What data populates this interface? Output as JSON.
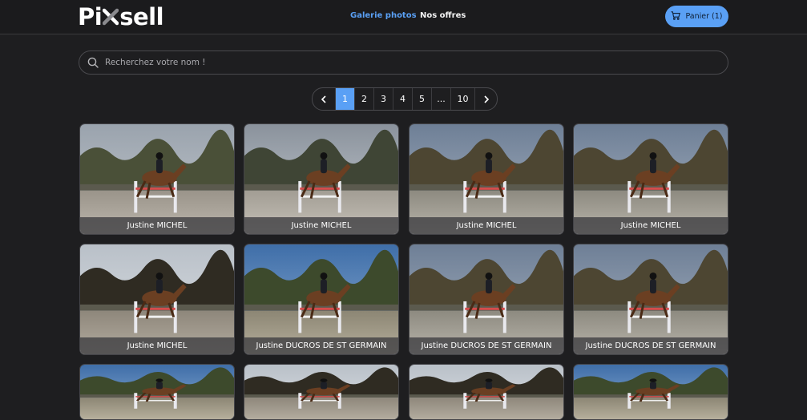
{
  "header": {
    "logo_prefix": "Pi",
    "logo_suffix": "sell",
    "nav": [
      {
        "label": "Galerie photos",
        "active": true
      },
      {
        "label": "Nos offres",
        "active": false
      }
    ],
    "cart_label": "Panier (1)"
  },
  "search": {
    "placeholder": "Recherchez votre nom !"
  },
  "pagination": {
    "pages": [
      "1",
      "2",
      "3",
      "4",
      "5",
      "...",
      "10"
    ],
    "current": "1"
  },
  "photos": [
    {
      "caption": "Justine MICHEL",
      "scene": "arena-barn"
    },
    {
      "caption": "Justine MICHEL",
      "scene": "arena-cloudy"
    },
    {
      "caption": "Justine MICHEL",
      "scene": "trees-blue"
    },
    {
      "caption": "Justine MICHEL",
      "scene": "trees-blue"
    },
    {
      "caption": "Justine MICHEL",
      "scene": "woods"
    },
    {
      "caption": "Justine DUCROS DE ST GERMAIN",
      "scene": "sky-blue"
    },
    {
      "caption": "Justine DUCROS DE ST GERMAIN",
      "scene": "trees-blue"
    },
    {
      "caption": "Justine DUCROS DE ST GERMAIN",
      "scene": "trees-blue"
    },
    {
      "caption": "",
      "scene": "sky-blue"
    },
    {
      "caption": "",
      "scene": "woods"
    },
    {
      "caption": "",
      "scene": "woods"
    },
    {
      "caption": "",
      "scene": "sky-blue"
    }
  ],
  "colors": {
    "accent": "#5aa0f5",
    "background": "#1e1e20"
  }
}
